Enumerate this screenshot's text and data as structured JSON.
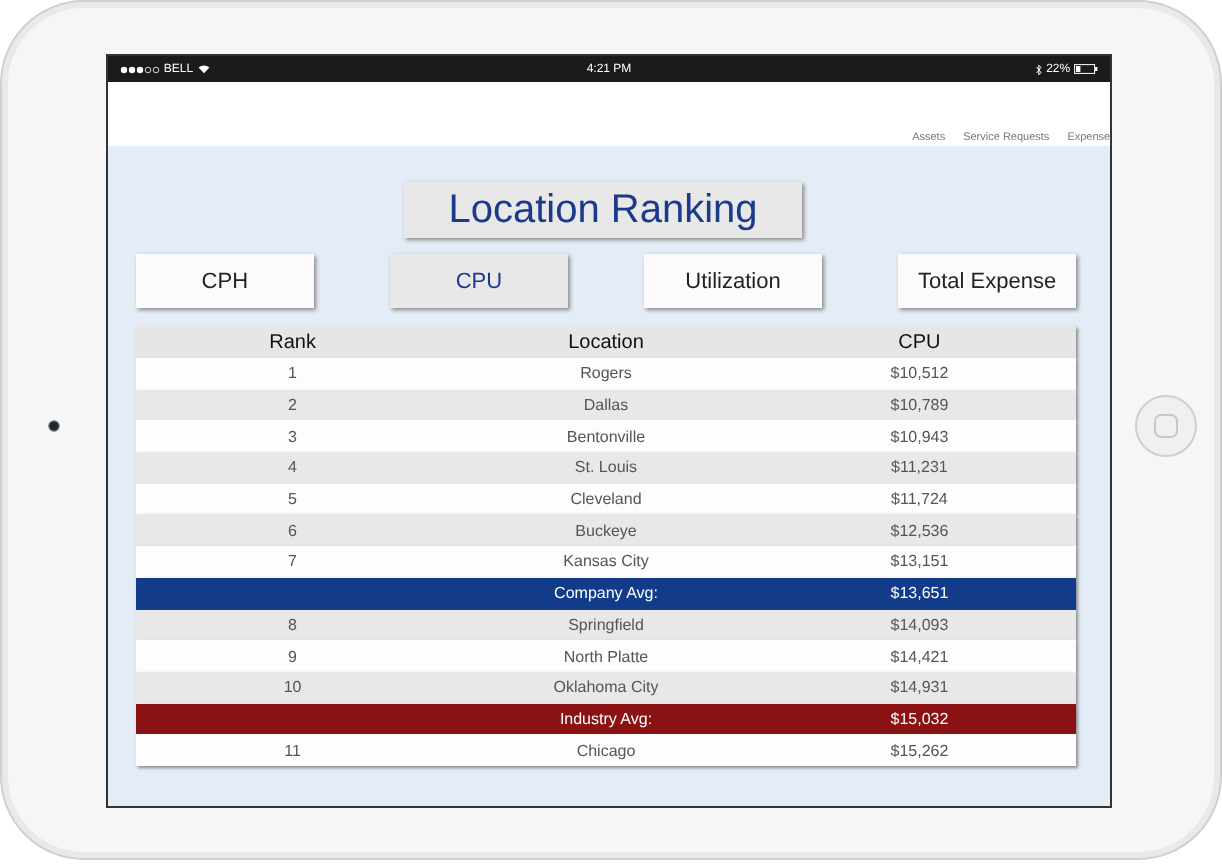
{
  "status_bar": {
    "carrier": "BELL",
    "time": "4:21 PM",
    "battery": "22%"
  },
  "nav": [
    {
      "label": "Assets"
    },
    {
      "label": "Service Requests"
    },
    {
      "label": "Expense"
    }
  ],
  "title": "Location Ranking",
  "tabs": [
    {
      "label": "CPH",
      "selected": false
    },
    {
      "label": "CPU",
      "selected": true
    },
    {
      "label": "Utilization",
      "selected": false
    },
    {
      "label": "Total Expense",
      "selected": false
    }
  ],
  "table": {
    "columns": [
      "Rank",
      "Location",
      "CPU"
    ],
    "rows": [
      {
        "kind": "rank",
        "rank": "1",
        "location": "Rogers",
        "cpu": "$10,512"
      },
      {
        "kind": "rank",
        "rank": "2",
        "location": "Dallas",
        "cpu": "$10,789"
      },
      {
        "kind": "rank",
        "rank": "3",
        "location": "Bentonville",
        "cpu": "$10,943"
      },
      {
        "kind": "rank",
        "rank": "4",
        "location": "St. Louis",
        "cpu": "$11,231"
      },
      {
        "kind": "rank",
        "rank": "5",
        "location": "Cleveland",
        "cpu": "$11,724"
      },
      {
        "kind": "rank",
        "rank": "6",
        "location": "Buckeye",
        "cpu": "$12,536"
      },
      {
        "kind": "rank",
        "rank": "7",
        "location": "Kansas City",
        "cpu": "$13,151"
      },
      {
        "kind": "company_avg",
        "location": "Company Avg:",
        "cpu": "$13,651"
      },
      {
        "kind": "rank",
        "rank": "8",
        "location": "Springfield",
        "cpu": "$14,093"
      },
      {
        "kind": "rank",
        "rank": "9",
        "location": "North Platte",
        "cpu": "$14,421"
      },
      {
        "kind": "rank",
        "rank": "10",
        "location": "Oklahoma City",
        "cpu": "$14,931"
      },
      {
        "kind": "industry_avg",
        "location": "Industry Avg:",
        "cpu": "$15,032"
      },
      {
        "kind": "rank",
        "rank": "11",
        "location": "Chicago",
        "cpu": "$15,262"
      }
    ]
  }
}
